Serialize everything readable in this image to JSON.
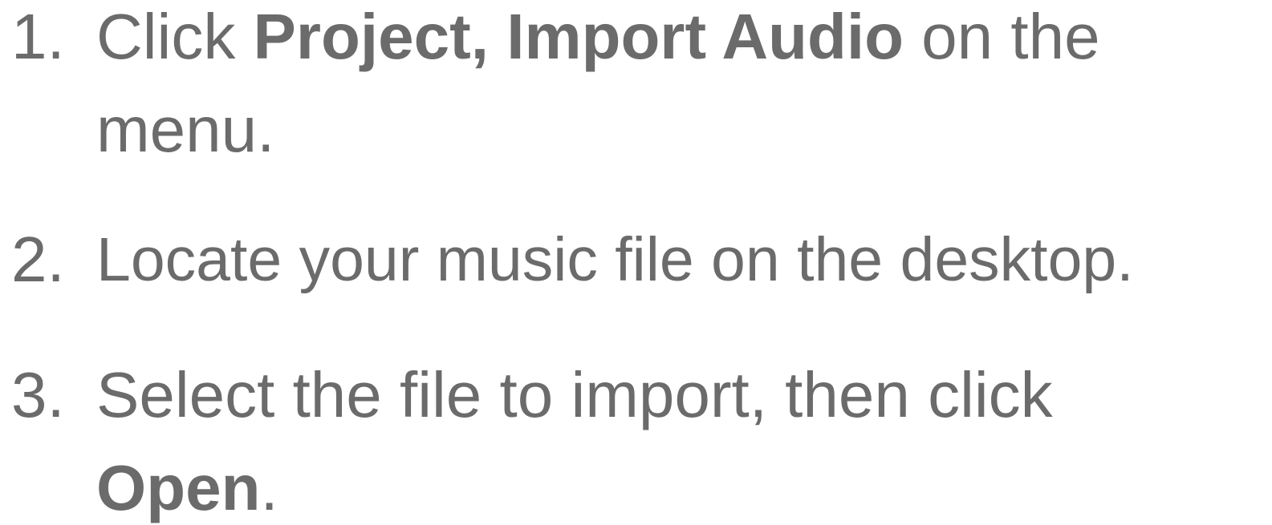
{
  "steps": [
    {
      "number": "1.",
      "pre": "Click ",
      "bold": "Project, Import Audio",
      "post": " on the menu."
    },
    {
      "number": "2.",
      "pre": "Locate your music file on the desktop.",
      "bold": "",
      "post": ""
    },
    {
      "number": "3.",
      "pre": "Select the file to import, then click ",
      "bold": "Open",
      "post": "."
    }
  ]
}
